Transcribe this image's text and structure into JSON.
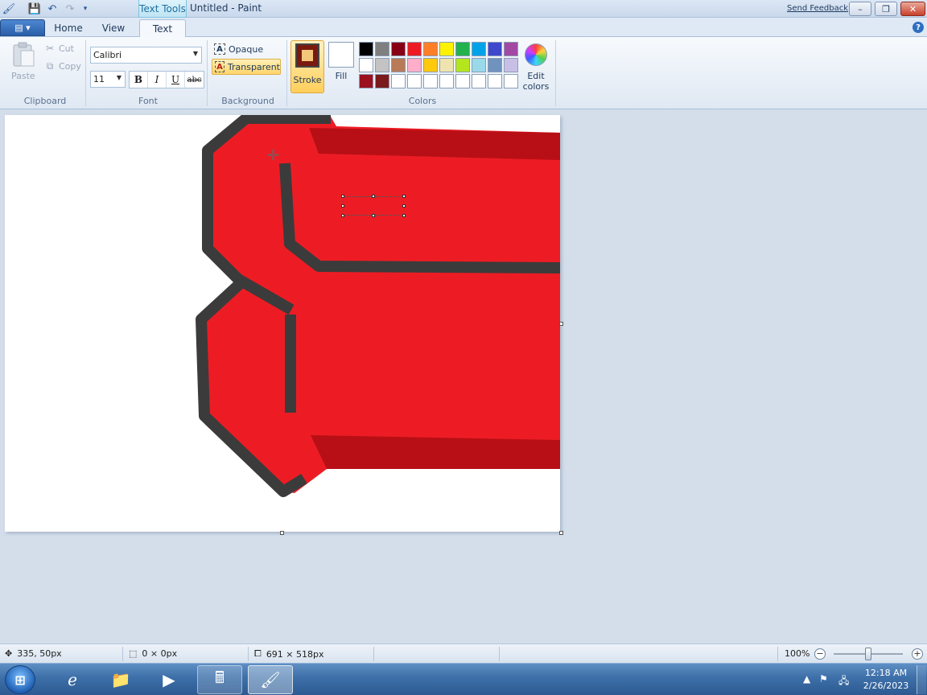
{
  "titlebar": {
    "context_tab": "Text Tools",
    "title": "Untitled - Paint",
    "feedback_link": "Send Feedback",
    "minimize": "–",
    "maximize": "❐",
    "close": "✕"
  },
  "tabs": {
    "app_menu": "▤ ▾",
    "home": "Home",
    "view": "View",
    "text": "Text"
  },
  "ribbon": {
    "clipboard": {
      "paste": "Paste",
      "cut": "Cut",
      "copy": "Copy",
      "label": "Clipboard"
    },
    "font": {
      "family": "Calibri",
      "size": "11",
      "bold": "B",
      "italic": "I",
      "underline": "U",
      "strike": "abc",
      "label": "Font"
    },
    "background": {
      "opaque": "Opaque",
      "transparent": "Transparent",
      "label": "Background",
      "selected": "transparent"
    },
    "colors": {
      "stroke_label": "Stroke",
      "fill_label": "Fill",
      "stroke_color": "#7a1a0f",
      "fill_color": "#ffffff",
      "edit_label_1": "Edit",
      "edit_label_2": "colors",
      "label": "Colors",
      "palette": [
        "#000000",
        "#7f7f7f",
        "#880015",
        "#ed1c24",
        "#ff7f27",
        "#fff200",
        "#22b14c",
        "#00a2e8",
        "#3f48cc",
        "#a349a4",
        "#ffffff",
        "#c3c3c3",
        "#b97a57",
        "#ffaec9",
        "#ffc90e",
        "#efe4b0",
        "#b5e61d",
        "#99d9ea",
        "#7092be",
        "#c8bfe7",
        "#9b111e",
        "#7a1a1a",
        "#ffffff",
        "#ffffff",
        "#ffffff",
        "#ffffff",
        "#ffffff",
        "#ffffff",
        "#ffffff",
        "#ffffff"
      ]
    }
  },
  "status": {
    "cursor_pos": "335, 50px",
    "selection_size": "0 × 0px",
    "canvas_size": "691 × 518px",
    "zoom": "100%"
  },
  "taskbar": {
    "time": "12:18 AM",
    "date": "2/26/2023"
  }
}
